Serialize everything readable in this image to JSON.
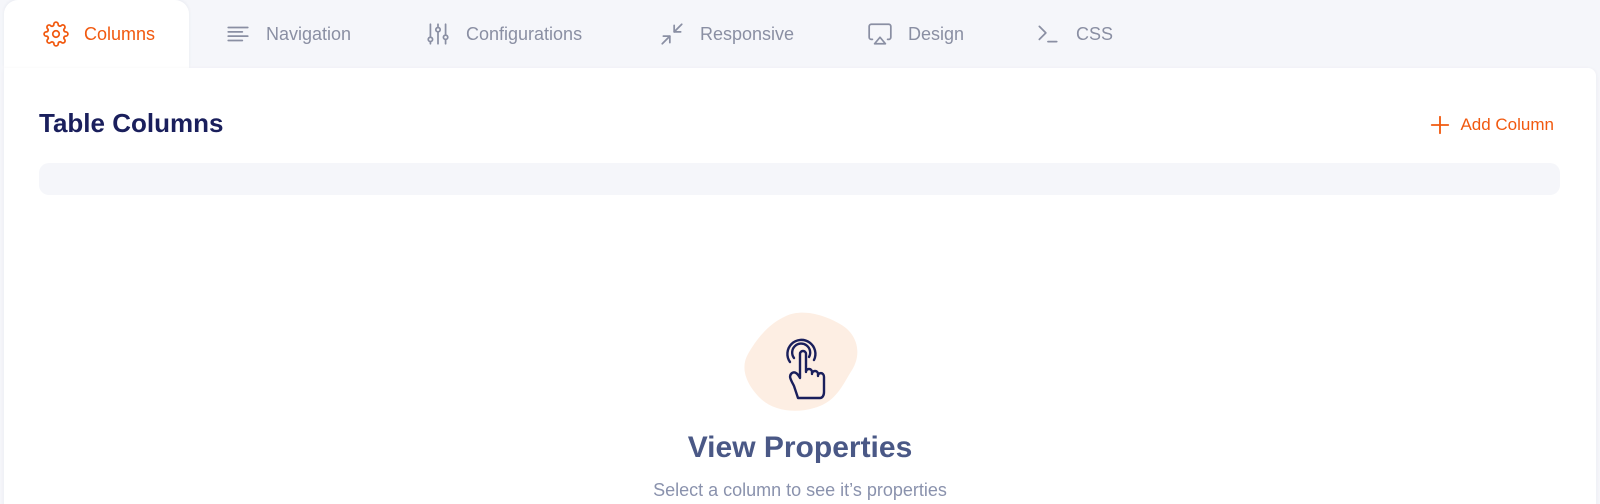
{
  "tabs": [
    {
      "label": "Columns",
      "icon": "gear-icon",
      "active": true
    },
    {
      "label": "Navigation",
      "icon": "align-left-icon",
      "active": false
    },
    {
      "label": "Configurations",
      "icon": "sliders-icon",
      "active": false
    },
    {
      "label": "Responsive",
      "icon": "collapse-arrows-icon",
      "active": false
    },
    {
      "label": "Design",
      "icon": "airplay-icon",
      "active": false
    },
    {
      "label": "CSS",
      "icon": "terminal-icon",
      "active": false
    }
  ],
  "panel": {
    "title": "Table Columns",
    "add_button_label": "Add Column",
    "empty_state": {
      "title": "View Properties",
      "subtitle": "Select a column to see it’s properties",
      "icon": "tap-hand-icon"
    }
  },
  "colors": {
    "accent": "#f1590f",
    "title": "#1a1f5c",
    "muted": "#8a8fa3",
    "background": "#f5f6fa"
  }
}
